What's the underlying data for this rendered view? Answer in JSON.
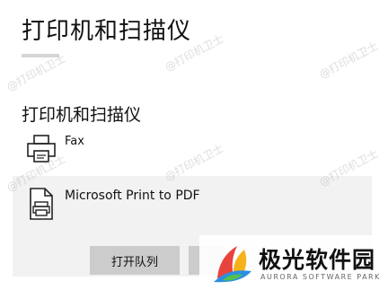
{
  "page": {
    "title": "打印机和扫描仪"
  },
  "section": {
    "title": "打印机和扫描仪"
  },
  "printers": [
    {
      "name": "Fax",
      "icon": "fax-printer-icon"
    },
    {
      "name": "Microsoft Print to PDF",
      "icon": "pdf-printer-icon",
      "selected": true
    }
  ],
  "actions": {
    "open_queue_label": "打开队列",
    "manage_label": ""
  },
  "watermark": {
    "text": "@打印机卫士"
  },
  "logo": {
    "name": "极光软件园",
    "sub": "AURORA SOFTWARE PARK"
  },
  "colors": {
    "selected_row": "#f2f2f2",
    "button": "#cccccc",
    "accent_underline": "#d6d6d6"
  }
}
